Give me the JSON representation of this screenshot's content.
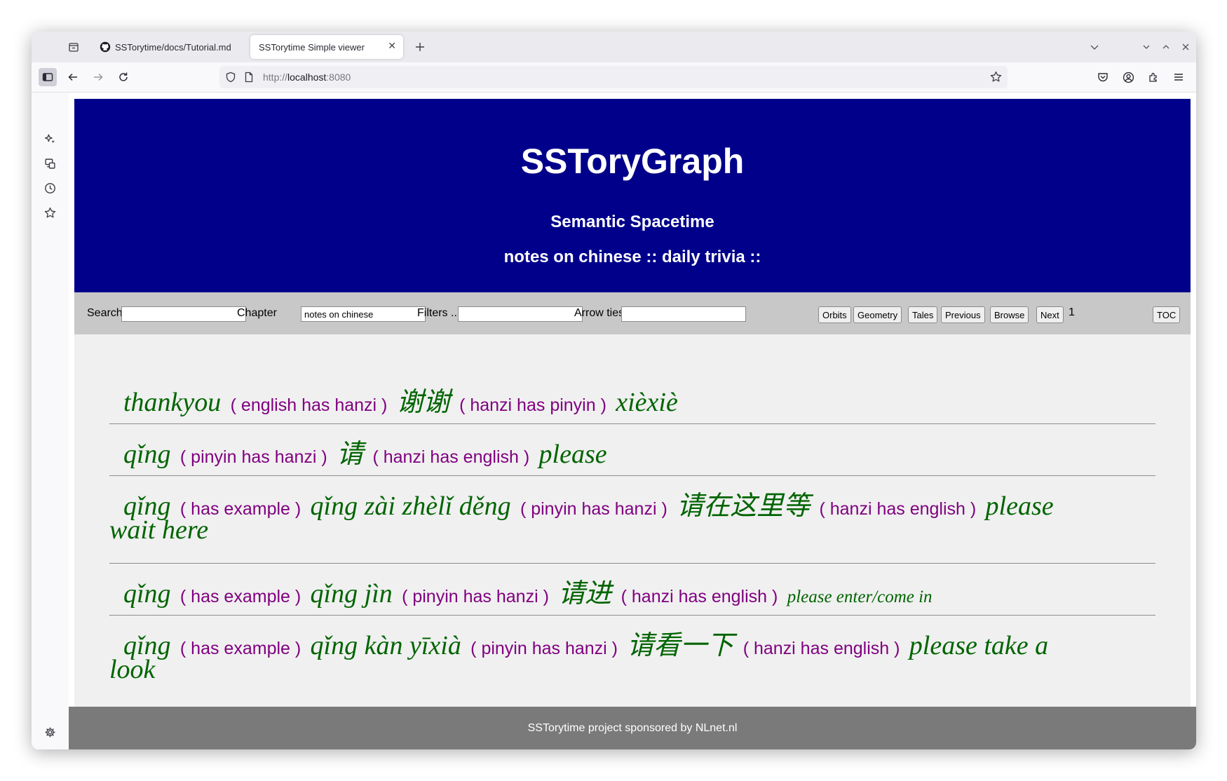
{
  "browser": {
    "tabs": [
      {
        "title": "SSTorytime/docs/Tutorial.md",
        "active": false,
        "icon": "github-icon"
      },
      {
        "title": "SSTorytime Simple viewer",
        "active": true
      }
    ],
    "url_scheme": "http://",
    "url_host": "localhost",
    "url_port": ":8080"
  },
  "header": {
    "title": "SSToryGraph",
    "subtitle": "Semantic Spacetime",
    "breadcrumb": "notes on chinese :: daily trivia ::"
  },
  "searchbar": {
    "search_label": "Search",
    "search_value": "",
    "chapter_label": "Chapter",
    "chapter_value": "notes on chinese",
    "filters_label": "Filters ...",
    "filters_value": "",
    "arrows_label": "Arrow ties",
    "arrows_value": "",
    "buttons": {
      "orbits": "Orbits",
      "geometry": "Geometry",
      "tales": "Tales",
      "previous": "Previous",
      "browse": "Browse",
      "next": "Next",
      "toc": "TOC"
    },
    "page_number": "1"
  },
  "results": [
    {
      "l1": [
        "thankyou",
        "( english has hanzi )",
        "谢谢",
        "( hanzi has pinyin )",
        "xièxiè"
      ]
    },
    {
      "l1": [
        "qǐng",
        "( pinyin has hanzi )",
        "请",
        "( hanzi has english )",
        "please"
      ]
    },
    {
      "l1": [
        "qǐng",
        "( has example )",
        "qǐng zài zhèlǐ děng",
        "( pinyin has hanzi )",
        "请在这里等",
        "( hanzi has english )",
        "please"
      ],
      "l2": "wait here"
    },
    {
      "l1": [
        "qǐng",
        "( has example )",
        "qǐng jìn",
        "( pinyin has hanzi )",
        "请进",
        "( hanzi has english )",
        "please enter/come in"
      ]
    },
    {
      "l1": [
        "qǐng",
        "( has example )",
        "qǐng kàn yīxià",
        "( pinyin has hanzi )",
        "请看一下",
        "( hanzi has english )",
        "please take a"
      ],
      "l2": "look"
    }
  ],
  "footer": {
    "text": "SSTorytime project sponsored by NLnet.nl"
  }
}
